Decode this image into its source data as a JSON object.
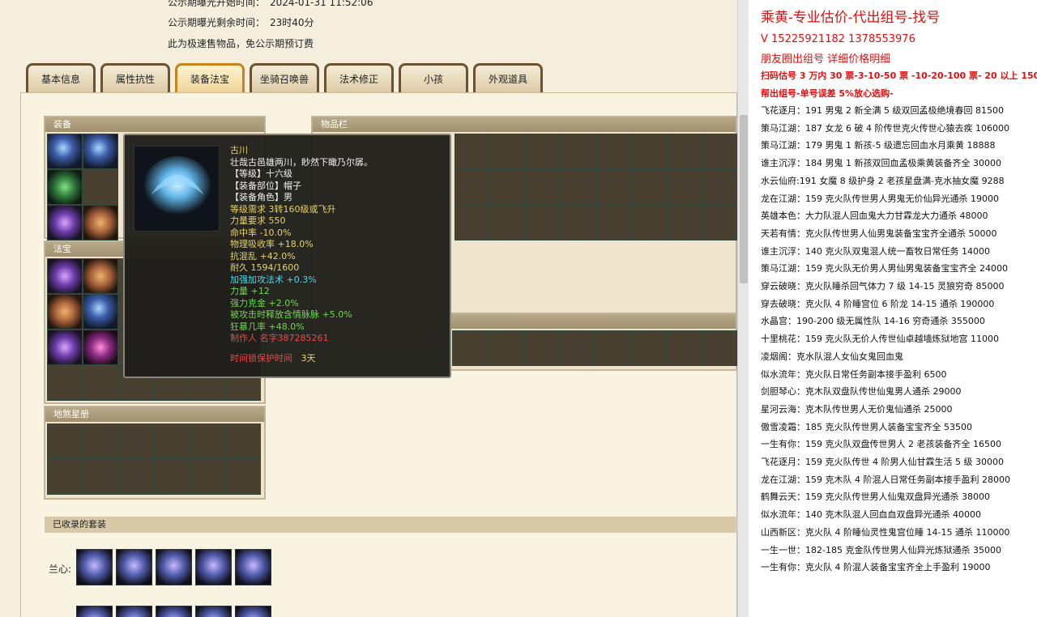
{
  "info": {
    "start_label": "公示期曝光开始时间：",
    "start_value": "2024-01-31 11:52:06",
    "remain_label": "公示期曝光剩余时间：",
    "remain_value": "23时40分",
    "note": "此为极速售物品，免公示期预订费"
  },
  "tabs": [
    {
      "label": "基本信息"
    },
    {
      "label": "属性抗性"
    },
    {
      "label": "装备法宝"
    },
    {
      "label": "坐骑召唤兽"
    },
    {
      "label": "法术修正"
    },
    {
      "label": "小孩"
    },
    {
      "label": "外观道具"
    }
  ],
  "panels": {
    "equip": "装备",
    "inventory": "物品栏",
    "fabao": "法宝",
    "dishe": "地煞星册",
    "suits": "已收录的套装"
  },
  "suit_label": "兰心:",
  "tooltip": {
    "name": "古川",
    "desc": "壮哉古邑雄两川，眇然下瞰乃尔孱。",
    "level": "【等级】十六级",
    "part": "【装备部位】帽子",
    "role": "【装备角色】男",
    "req": "等级需求 3转160级或飞升",
    "str_req": "力量要求 550",
    "hit": "命中率 -10.0%",
    "phys": "物理吸收率 +18.0%",
    "anti": "抗混乱 +42.0%",
    "dura": "耐久 1594/1600",
    "s1": "加强加攻法术 +0.3%",
    "s2": "力量 +12",
    "s3": "强力克金 +2.0%",
    "s4": "被攻击时释放含情脉脉 +5.0%",
    "s5": "狂暴几率 +48.0%",
    "maker": "制作人 名字387285261",
    "protect_label": "时间锁保护时间",
    "protect_value": "3天"
  },
  "doc": {
    "title": "乘黄-专业估价-代出组号-找号",
    "phone": "V 15225921182   1378553976",
    "circle": "朋友圈出组号    详细价格明细",
    "rate": "扫码估号 3 万内 30 票-3-10-50 票  -10-20-100 票- 20 以上 150",
    "help": "帮出组号-单号误差 5%放心选购-",
    "entries": [
      "飞花逐月：191 男鬼 2 新全满 5 级双回孟极绝境春回 81500",
      "策马江湖：187 女龙 6 破 4 阶传世克火传世心猿去疾 106000",
      "策马江湖：179 男鬼 1 新孩-5 级遗忘回血水月乘黄 18888",
      "谁主沉浮：184 男鬼 1 新孩双回血孟极乘黄装备齐全 30000",
      "水云仙府:191 女魔 8 级护身 2 老孩星盘满-克水抽女魔 9288",
      "龙在江湖：159 克火队传世男人男鬼无价仙异光通杀 19000",
      "英雄本色：大力队混人回血鬼大力甘霖龙大力通杀 48000",
      "天若有情：克火队传世男人仙男鬼装备宝宝齐全通杀 50000",
      "谁主沉浮：140 克火队双鬼混人统一畜牧日常任务 14000",
      "策马江湖：159 克火队无价男人男仙男鬼装备宝宝齐全 24000",
      "穿云破晓：克火队睡杀回气体力 7 级 14-15 灵狼穷奇 85000",
      "穿去破晓：克火队 4 阶睡宫位 6 阶龙 14-15 通杀 190000",
      "水晶宫：190-200 级无属性队 14-16 穷奇通杀 355000",
      "十里桃花：159 克火队无价人传世仙卓越墙炼狱地宫 11000",
      "凌烟阁：克水队混人女仙女鬼回血鬼",
      "似水流年：克火队日常任务副本接手盈利 6500",
      "剑胆琴心：克木队双盘队传世仙鬼男人通杀 29000",
      "星河云海：克木队传世男人无价鬼仙通杀 25000",
      "傲雪凌霜：185 克火队传世男人装备宝宝齐全 53500",
      "一生有你：159 克火队双盘传世男人 2 老孩装备齐全 16500",
      "飞花逐月：159 克火队传世 4 阶男人仙甘霖生活 5 级 30000",
      "龙在江湖：159 克木队 4 阶混人日常任务副本接手盈利 28000",
      "鹤舞云天：159 克火队传世男人仙鬼双盘异光通杀 38000",
      "似水流年：140 克木队混人回血血双盘异光通杀 40000",
      "山西新区：克火队 4 阶睡仙灵性鬼宫位睡 14-15 通杀 110000",
      "一生一世：182-185 克金队传世男人仙异光炼狱通杀 35000",
      "一生有你：克火队 4 阶混人装备宝宝齐全上手盈利 19000"
    ]
  }
}
